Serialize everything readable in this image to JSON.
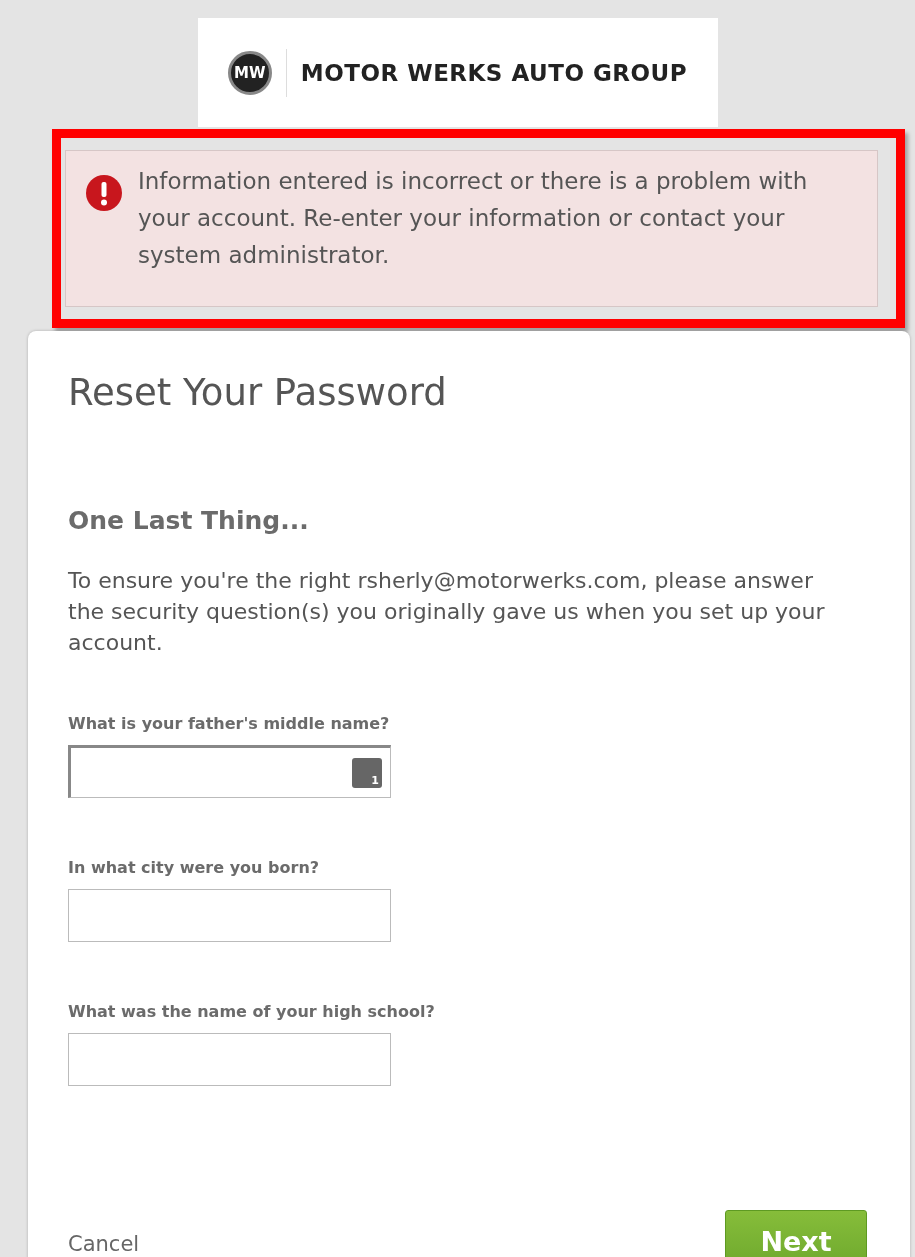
{
  "logo": {
    "mark": "MW",
    "name": "MOTOR WERKS AUTO GROUP"
  },
  "alert": {
    "message": "Information entered is incorrect or there is a problem with your account. Re-enter your information or contact your system administrator.",
    "highlighted": true
  },
  "title": "Reset Your Password",
  "heading": "One Last Thing...",
  "intro": "To ensure you're the right rsherly@motorwerks.com, please answer the security question(s) you originally gave us when you set up your account.",
  "fields": [
    {
      "label": "What is your father's middle name?",
      "focused": true,
      "badge": "1"
    },
    {
      "label": "In what city were you born?",
      "focused": false
    },
    {
      "label": "What was the name of your high school?",
      "focused": false
    }
  ],
  "actions": {
    "cancel": "Cancel",
    "next": "Next"
  }
}
